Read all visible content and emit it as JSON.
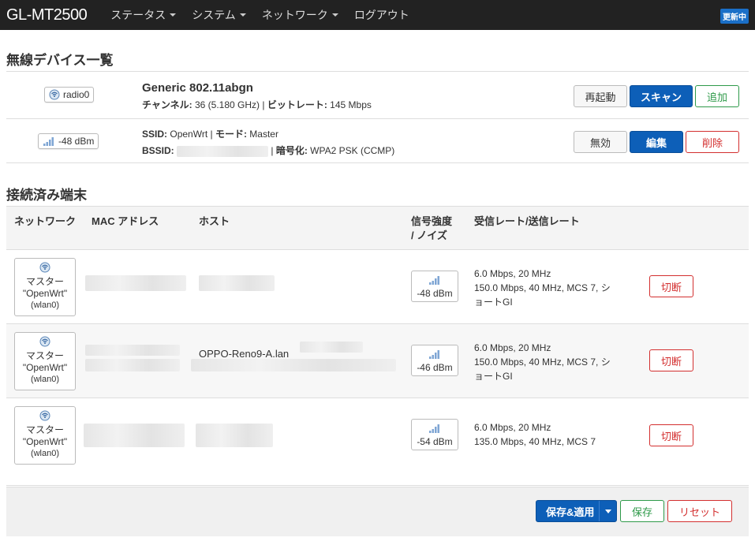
{
  "nav": {
    "brand": "GL-MT2500",
    "menu": [
      {
        "label": "ステータス",
        "has_caret": true
      },
      {
        "label": "システム",
        "has_caret": true
      },
      {
        "label": "ネットワーク",
        "has_caret": true
      },
      {
        "label": "ログアウト",
        "has_caret": false
      }
    ],
    "status_badge": "更新中"
  },
  "wireless": {
    "title": "無線デバイス一覧",
    "device": {
      "badge": "radio0",
      "name": "Generic 802.11abgn",
      "channel_label": "チャンネル:",
      "channel_value": "36 (5.180 GHz)",
      "bitrate_label": "ビットレート:",
      "bitrate_value": "145 Mbps",
      "buttons": {
        "restart": "再起動",
        "scan": "スキャン",
        "add": "追加"
      }
    },
    "network": {
      "badge": "-48 dBm",
      "ssid_label": "SSID:",
      "ssid_value": "OpenWrt",
      "mode_label": "モード:",
      "mode_value": "Master",
      "bssid_label": "BSSID:",
      "enc_label": "暗号化:",
      "enc_value": "WPA2 PSK (CCMP)",
      "buttons": {
        "disable": "無効",
        "edit": "編集",
        "delete": "削除"
      }
    }
  },
  "stations": {
    "title": "接続済み端末",
    "headers": {
      "network": "ネットワーク",
      "mac": "MAC アドレス",
      "host": "ホスト",
      "signal_line1": "信号強度",
      "signal_line2": "/ ノイズ",
      "rate": "受信レート/送信レート"
    },
    "rows": [
      {
        "net_mode": "マスター",
        "net_ssid": "\"OpenWrt\"",
        "net_iface": "(wlan0)",
        "host": "",
        "signal": "-48 dBm",
        "rate_rx": "6.0 Mbps, 20 MHz",
        "rate_tx_1": "150.0 Mbps, 40 MHz, MCS 7, シ",
        "rate_tx_2": "ョートGI",
        "disconnect": "切断"
      },
      {
        "net_mode": "マスター",
        "net_ssid": "\"OpenWrt\"",
        "net_iface": "(wlan0)",
        "host": "OPPO-Reno9-A.lan",
        "signal": "-46 dBm",
        "rate_rx": "6.0 Mbps, 20 MHz",
        "rate_tx_1": "150.0 Mbps, 40 MHz, MCS 7, シ",
        "rate_tx_2": "ョートGI",
        "disconnect": "切断"
      },
      {
        "net_mode": "マスター",
        "net_ssid": "\"OpenWrt\"",
        "net_iface": "(wlan0)",
        "host": "",
        "signal": "-54 dBm",
        "rate_rx": "6.0 Mbps, 20 MHz",
        "rate_tx_1": "135.0 Mbps, 40 MHz, MCS 7",
        "rate_tx_2": "",
        "disconnect": "切断"
      }
    ]
  },
  "footer": {
    "save_apply": "保存&適用",
    "save": "保存",
    "reset": "リセット"
  },
  "colors": {
    "navbar": "#222222",
    "primary": "#0d5fb8",
    "success": "#2f9a4a",
    "danger": "#d32f2f"
  }
}
